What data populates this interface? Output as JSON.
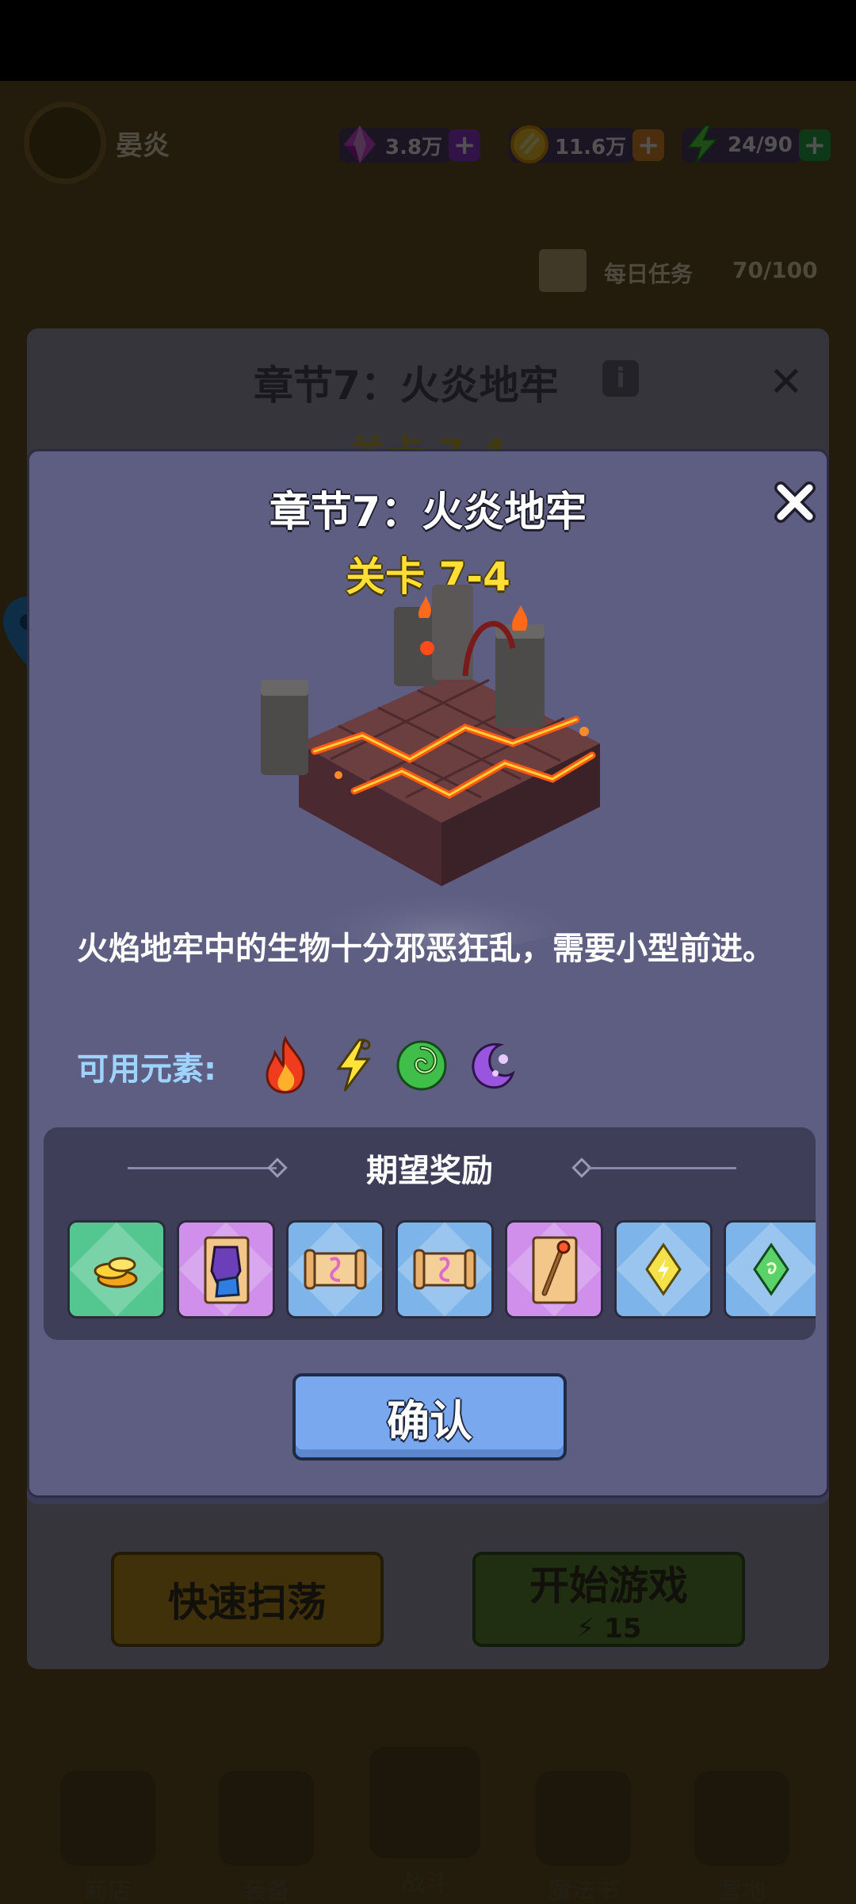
{
  "header": {
    "player_name": "晏炎",
    "resources": [
      {
        "icon": "purple-gem-icon",
        "value": "3.8万",
        "plus_color": "#9b3be0"
      },
      {
        "icon": "gold-coin-icon",
        "value": "11.6万",
        "plus_color": "#e8902e"
      },
      {
        "icon": "energy-bolt-icon",
        "value": "24/90",
        "plus_color": "#2db24c"
      }
    ],
    "daily_task": {
      "label": "每日任务",
      "count": "70/100"
    }
  },
  "background_panel": {
    "title": "章节7：火炎地牢",
    "level": "关卡 7-4",
    "sweep_button": "快速扫荡",
    "start_button": "开始游戏",
    "start_cost": "15"
  },
  "bottom_nav": [
    {
      "label": "商店"
    },
    {
      "label": "装备"
    },
    {
      "label": "战斗"
    },
    {
      "label": "魔法书"
    },
    {
      "label": "营地"
    }
  ],
  "modal": {
    "title": "章节7：火炎地牢",
    "level": "关卡 7-4",
    "description": "火焰地牢中的生物十分邪恶狂乱，需要小型前进。",
    "elements_label": "可用元素:",
    "elements": [
      "fire-icon",
      "lightning-icon",
      "wind-icon",
      "arcane-moon-icon"
    ],
    "rewards_title": "期望奖励",
    "rewards": [
      {
        "icon": "gold-coins-icon",
        "rarity": "green"
      },
      {
        "icon": "armor-scroll-icon",
        "rarity": "purple"
      },
      {
        "icon": "ribbon-scroll-icon",
        "rarity": "blue"
      },
      {
        "icon": "ribbon-scroll-icon",
        "rarity": "blue"
      },
      {
        "icon": "staff-scroll-icon",
        "rarity": "purple"
      },
      {
        "icon": "yellow-crystal-icon",
        "rarity": "blue"
      },
      {
        "icon": "green-crystal-icon",
        "rarity": "blue"
      }
    ],
    "confirm_button": "确认"
  }
}
